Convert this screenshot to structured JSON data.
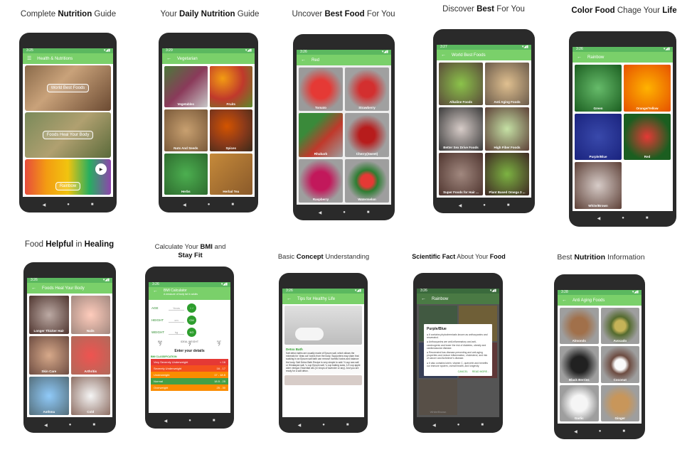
{
  "captions": [
    {
      "pre": "Complete ",
      "bold": "Nutrition",
      "post": " Guide"
    },
    {
      "pre": "Your ",
      "bold": "Daily Nutrition",
      "post": " Guide"
    },
    {
      "pre": "Uncover ",
      "bold": "Best Food",
      "post": " For You"
    },
    {
      "pre": "Discover ",
      "bold": "Best",
      "post": " For You"
    },
    {
      "b1": "Color Food",
      "mid": " Chage Your ",
      "b2": "Life"
    },
    {
      "pre": "Food ",
      "bold": "Helpful",
      "mid": " in ",
      "bold2": "Healing"
    },
    {
      "l1pre": "Calculate Your ",
      "l1bold": "BMI",
      "l1post": " and",
      "l2": "Stay Fit"
    },
    {
      "pre": "Basic ",
      "bold": "Concept",
      "post": " Understanding"
    },
    {
      "b1": "Scientific Fact",
      "mid": " About Your ",
      "b2": "Food"
    },
    {
      "pre": "Best ",
      "bold": "Nutrition",
      "post": " Information"
    }
  ],
  "p1": {
    "time": "3:25",
    "title": "Health & Nutritions",
    "banners": [
      "World Best Foods",
      "Foods Heal Your Body",
      "Rainbow"
    ]
  },
  "p2": {
    "time": "3:29",
    "title": "Vegetarian",
    "tiles": [
      "Vegetables",
      "Fruits",
      "Nuts And Seeds",
      "Spices",
      "Herbs",
      "Herbal Tea"
    ]
  },
  "p3": {
    "time": "3:26",
    "title": "Red",
    "tiles": [
      "Tomato",
      "Strawberry",
      "Rhubarb",
      "Cherry(Sweet)",
      "Raspberry",
      "Watermelon"
    ]
  },
  "p4": {
    "time": "3:27",
    "title": "World Best Foods",
    "tiles": [
      "Alkaline Foods",
      "Anti Aging Foods",
      "Better Sex Drive Foods",
      "High Fiber Foods",
      "Super Foods for Hair ...",
      "Plant Based Omega 3 ..."
    ]
  },
  "p5": {
    "time": "3:26",
    "title": "Rainbow",
    "tiles": [
      "Green",
      "Orange/Yellow",
      "Purple/Blue",
      "Red",
      "White/Brown"
    ]
  },
  "p6": {
    "time": "3:26",
    "title": "Foods Heal Your Body",
    "tiles": [
      "Longer Thicker Hair",
      "Nails",
      "Skin Care",
      "Arthritis",
      "Asthma",
      "Cold"
    ]
  },
  "p7": {
    "time": "3:26",
    "title": "BMI Calculator",
    "subtitle": "A measure of body fat in adults",
    "age": "AGE",
    "years": "Years",
    "height": "HEIGHT",
    "cm_ph": "cm",
    "cm": "CM",
    "weight": "WEIGHT",
    "kg_ph": "kg",
    "kg": "KG",
    "bmi": "BMI",
    "ideal": "IDEAL WEIGHT",
    "fat": "FAT",
    "q": "?",
    "enter": "Enter your details",
    "classification": "BMI CLASSIFICATION",
    "classes": [
      {
        "name": "Very Severely Underweight",
        "range": "< 16",
        "color": "#e53935"
      },
      {
        "name": "Severely Underweight",
        "range": "16 - 17",
        "color": "#f4511e"
      },
      {
        "name": "Underweight",
        "range": "17 - 18.5",
        "color": "#fb8c00"
      },
      {
        "name": "Normal",
        "range": "18.5 - 25",
        "color": "#43a047"
      },
      {
        "name": "Overweight",
        "range": "25 - 30",
        "color": "#fb8c00"
      }
    ]
  },
  "p8": {
    "time": "3:26",
    "title": "Tips for Healthy Life",
    "heading": "Detox Bath",
    "body": "Salt detox baths are usually made of Epsom salt, which allows the minerals for 'draw out' toxins from the body. Supporters may claim that soaking in an Epsom salt bath can remove harmful toxins and balance the body. Salt Detox Bath Recipe is very simple to add: ½ cup sea salt or Himalayan salt, ¼ cup Epsom salt, ¼ cup baking soda, 1/2 cup apple cider vinegar, Essential oils (10 drops of lavender or any). And you are ready for a salt detox."
  },
  "p9": {
    "time": "3:26",
    "title": "Rainbow",
    "dlg_title": "Purple/Blue",
    "dlg_body": [
      "It contains phytochemicals known as anthocyanins and resveratrol.",
      "Anthocyanins are anti-inflammatory and anti-carcinogenic and lower the risk of diabetes, obesity and cardiovascular disease.",
      "Resveratrol has disease-preventing and anti-aging properties and reduce inflammation, cholesterol, and risk of cancer and Alzheimer's disease.",
      "It also contains lutein, vitamin C, quercetin and benefits our immune system, overall health, and longevity."
    ],
    "cancel": "CANCEL",
    "read_more": "READ MORE...",
    "bg_label": "White/Brown"
  },
  "p10": {
    "time": "3:28",
    "title": "Anti Aging Foods",
    "tiles": [
      "Almonds",
      "Avocado",
      "Black Berries",
      "Coconut",
      "Garlic",
      "Ginger"
    ]
  }
}
